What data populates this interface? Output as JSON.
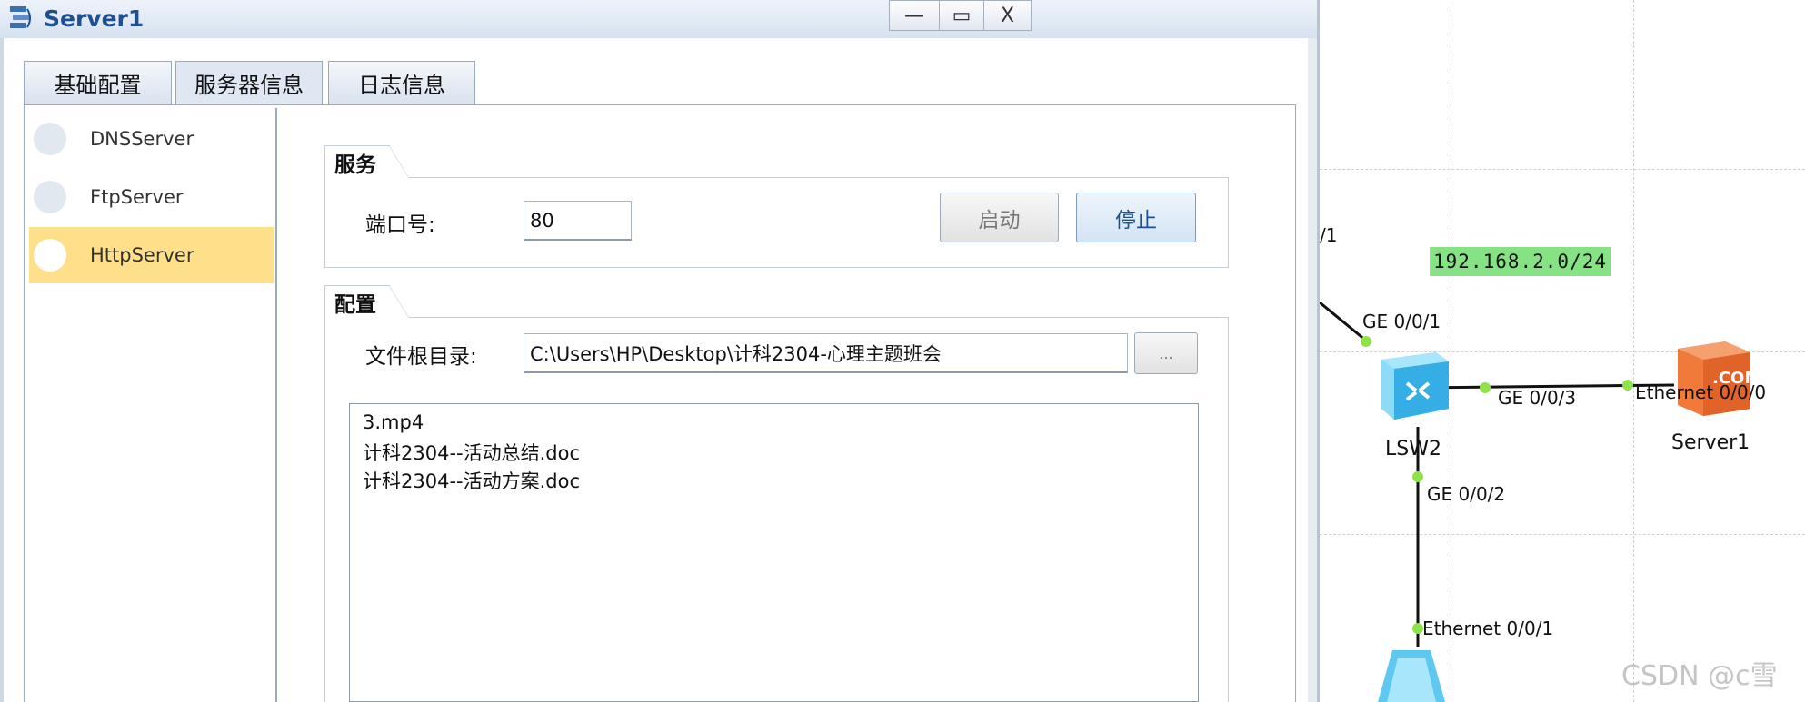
{
  "window": {
    "title": "Server1",
    "controls": {
      "minimize": "—",
      "maximize": "▭",
      "close": "X"
    }
  },
  "tabs": [
    {
      "label": "基础配置"
    },
    {
      "label": "服务器信息",
      "active": true
    },
    {
      "label": "日志信息"
    }
  ],
  "servers": [
    {
      "label": "DNSServer"
    },
    {
      "label": "FtpServer"
    },
    {
      "label": "HttpServer",
      "selected": true
    }
  ],
  "service": {
    "group_title": "服务",
    "port_label": "端口号:",
    "port_value": "80",
    "start_label": "启动",
    "stop_label": "停止"
  },
  "config": {
    "group_title": "配置",
    "root_label": "文件根目录:",
    "root_value": "C:\\Users\\HP\\Desktop\\计科2304-心理主题班会",
    "browse_label": "...",
    "files": [
      "3.mp4",
      "计科2304--活动总结.doc",
      "计科2304--活动方案.doc"
    ]
  },
  "topology": {
    "partial_label": "/1",
    "subnet": "192.168.2.0/24",
    "switch": {
      "name": "LSW2",
      "ports": [
        "GE 0/0/1",
        "GE 0/0/3",
        "GE 0/0/2"
      ]
    },
    "server": {
      "name": "Server1",
      "port": "Ethernet 0/0/0",
      "icon_text": ".COM"
    },
    "lower_port": "Ethernet 0/0/1"
  },
  "watermark": "CSDN @c雪",
  "colors": {
    "title_text": "#1d4f91",
    "selected_row": "#ffe08a",
    "subnet_bg": "#86e383",
    "link_dot": "#8ee24a"
  }
}
